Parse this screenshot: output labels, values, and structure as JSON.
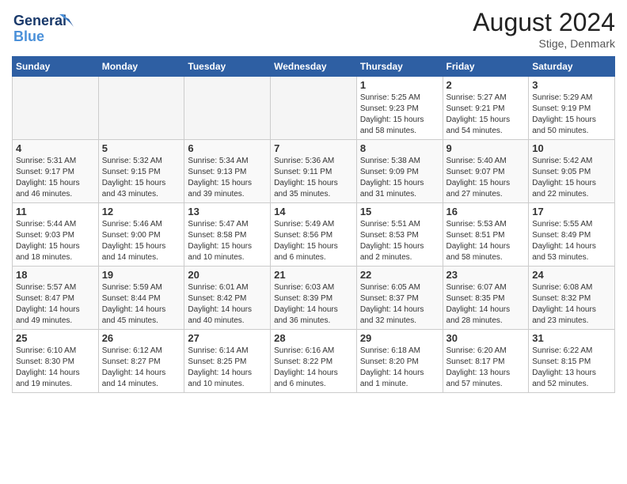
{
  "header": {
    "logo": {
      "line1": "General",
      "line2": "Blue"
    },
    "title": "August 2024",
    "location": "Stige, Denmark"
  },
  "days_of_week": [
    "Sunday",
    "Monday",
    "Tuesday",
    "Wednesday",
    "Thursday",
    "Friday",
    "Saturday"
  ],
  "weeks": [
    [
      {
        "day": "",
        "info": ""
      },
      {
        "day": "",
        "info": ""
      },
      {
        "day": "",
        "info": ""
      },
      {
        "day": "",
        "info": ""
      },
      {
        "day": "1",
        "info": "Sunrise: 5:25 AM\nSunset: 9:23 PM\nDaylight: 15 hours\nand 58 minutes."
      },
      {
        "day": "2",
        "info": "Sunrise: 5:27 AM\nSunset: 9:21 PM\nDaylight: 15 hours\nand 54 minutes."
      },
      {
        "day": "3",
        "info": "Sunrise: 5:29 AM\nSunset: 9:19 PM\nDaylight: 15 hours\nand 50 minutes."
      }
    ],
    [
      {
        "day": "4",
        "info": "Sunrise: 5:31 AM\nSunset: 9:17 PM\nDaylight: 15 hours\nand 46 minutes."
      },
      {
        "day": "5",
        "info": "Sunrise: 5:32 AM\nSunset: 9:15 PM\nDaylight: 15 hours\nand 43 minutes."
      },
      {
        "day": "6",
        "info": "Sunrise: 5:34 AM\nSunset: 9:13 PM\nDaylight: 15 hours\nand 39 minutes."
      },
      {
        "day": "7",
        "info": "Sunrise: 5:36 AM\nSunset: 9:11 PM\nDaylight: 15 hours\nand 35 minutes."
      },
      {
        "day": "8",
        "info": "Sunrise: 5:38 AM\nSunset: 9:09 PM\nDaylight: 15 hours\nand 31 minutes."
      },
      {
        "day": "9",
        "info": "Sunrise: 5:40 AM\nSunset: 9:07 PM\nDaylight: 15 hours\nand 27 minutes."
      },
      {
        "day": "10",
        "info": "Sunrise: 5:42 AM\nSunset: 9:05 PM\nDaylight: 15 hours\nand 22 minutes."
      }
    ],
    [
      {
        "day": "11",
        "info": "Sunrise: 5:44 AM\nSunset: 9:03 PM\nDaylight: 15 hours\nand 18 minutes."
      },
      {
        "day": "12",
        "info": "Sunrise: 5:46 AM\nSunset: 9:00 PM\nDaylight: 15 hours\nand 14 minutes."
      },
      {
        "day": "13",
        "info": "Sunrise: 5:47 AM\nSunset: 8:58 PM\nDaylight: 15 hours\nand 10 minutes."
      },
      {
        "day": "14",
        "info": "Sunrise: 5:49 AM\nSunset: 8:56 PM\nDaylight: 15 hours\nand 6 minutes."
      },
      {
        "day": "15",
        "info": "Sunrise: 5:51 AM\nSunset: 8:53 PM\nDaylight: 15 hours\nand 2 minutes."
      },
      {
        "day": "16",
        "info": "Sunrise: 5:53 AM\nSunset: 8:51 PM\nDaylight: 14 hours\nand 58 minutes."
      },
      {
        "day": "17",
        "info": "Sunrise: 5:55 AM\nSunset: 8:49 PM\nDaylight: 14 hours\nand 53 minutes."
      }
    ],
    [
      {
        "day": "18",
        "info": "Sunrise: 5:57 AM\nSunset: 8:47 PM\nDaylight: 14 hours\nand 49 minutes."
      },
      {
        "day": "19",
        "info": "Sunrise: 5:59 AM\nSunset: 8:44 PM\nDaylight: 14 hours\nand 45 minutes."
      },
      {
        "day": "20",
        "info": "Sunrise: 6:01 AM\nSunset: 8:42 PM\nDaylight: 14 hours\nand 40 minutes."
      },
      {
        "day": "21",
        "info": "Sunrise: 6:03 AM\nSunset: 8:39 PM\nDaylight: 14 hours\nand 36 minutes."
      },
      {
        "day": "22",
        "info": "Sunrise: 6:05 AM\nSunset: 8:37 PM\nDaylight: 14 hours\nand 32 minutes."
      },
      {
        "day": "23",
        "info": "Sunrise: 6:07 AM\nSunset: 8:35 PM\nDaylight: 14 hours\nand 28 minutes."
      },
      {
        "day": "24",
        "info": "Sunrise: 6:08 AM\nSunset: 8:32 PM\nDaylight: 14 hours\nand 23 minutes."
      }
    ],
    [
      {
        "day": "25",
        "info": "Sunrise: 6:10 AM\nSunset: 8:30 PM\nDaylight: 14 hours\nand 19 minutes."
      },
      {
        "day": "26",
        "info": "Sunrise: 6:12 AM\nSunset: 8:27 PM\nDaylight: 14 hours\nand 14 minutes."
      },
      {
        "day": "27",
        "info": "Sunrise: 6:14 AM\nSunset: 8:25 PM\nDaylight: 14 hours\nand 10 minutes."
      },
      {
        "day": "28",
        "info": "Sunrise: 6:16 AM\nSunset: 8:22 PM\nDaylight: 14 hours\nand 6 minutes."
      },
      {
        "day": "29",
        "info": "Sunrise: 6:18 AM\nSunset: 8:20 PM\nDaylight: 14 hours\nand 1 minute."
      },
      {
        "day": "30",
        "info": "Sunrise: 6:20 AM\nSunset: 8:17 PM\nDaylight: 13 hours\nand 57 minutes."
      },
      {
        "day": "31",
        "info": "Sunrise: 6:22 AM\nSunset: 8:15 PM\nDaylight: 13 hours\nand 52 minutes."
      }
    ]
  ]
}
